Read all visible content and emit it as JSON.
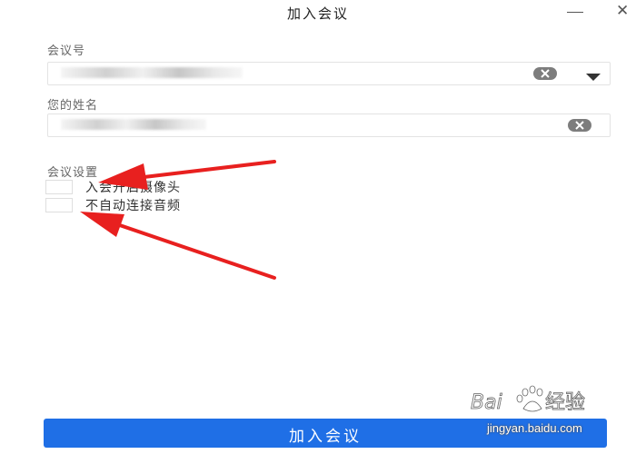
{
  "window": {
    "title": "加入会议"
  },
  "meeting_id": {
    "label": "会议号",
    "value": ""
  },
  "your_name": {
    "label": "您的姓名",
    "value": ""
  },
  "settings": {
    "label": "会议设置",
    "options": [
      {
        "label": "入会开启摄像头",
        "checked": false
      },
      {
        "label": "不自动连接音频",
        "checked": false
      }
    ]
  },
  "join_button": {
    "label": "加入会议"
  },
  "colors": {
    "primary": "#1f6fe6",
    "annotation_arrow": "#e8201f"
  },
  "watermark": {
    "logo": "Baidu经验",
    "url": "jingyan.baidu.com"
  },
  "icons": {
    "minimize": "minimize-icon",
    "close": "close-icon",
    "clear": "clear-icon",
    "dropdown": "chevron-down-icon"
  }
}
